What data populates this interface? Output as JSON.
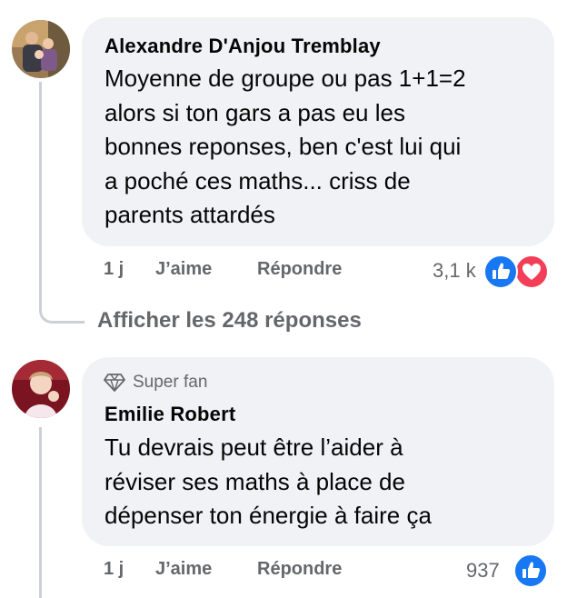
{
  "comments": [
    {
      "author": "Alexandre D'Anjou Tremblay",
      "text": "Moyenne de groupe ou pas 1+1=2\nalors si ton gars a pas eu les\nbonnes reponses, ben c'est lui qui\na poché ces maths... criss de\nparents attardés",
      "time": "1 j",
      "like_label": "J’aime",
      "reply_label": "Répondre",
      "reaction_count": "3,1 k",
      "reactions": [
        "like-icon",
        "love-icon"
      ],
      "view_replies": "Afficher les 248 réponses"
    },
    {
      "badge": "Super fan",
      "badge_icon": "diamond-icon",
      "author": "Emilie Robert",
      "text": "Tu devrais peut être l’aider à\nréviser ses maths à place de\ndépenser ton énergie à faire ça",
      "time": "1 j",
      "like_label": "J’aime",
      "reply_label": "Répondre",
      "reaction_count": "937",
      "reactions": [
        "like-icon"
      ]
    }
  ],
  "colors": {
    "bubble": "#f0f2f5",
    "meta_text": "#65676b",
    "like_blue": "#1877f2",
    "love_red": "#f33e58",
    "thread_line": "#ccd0d5"
  }
}
